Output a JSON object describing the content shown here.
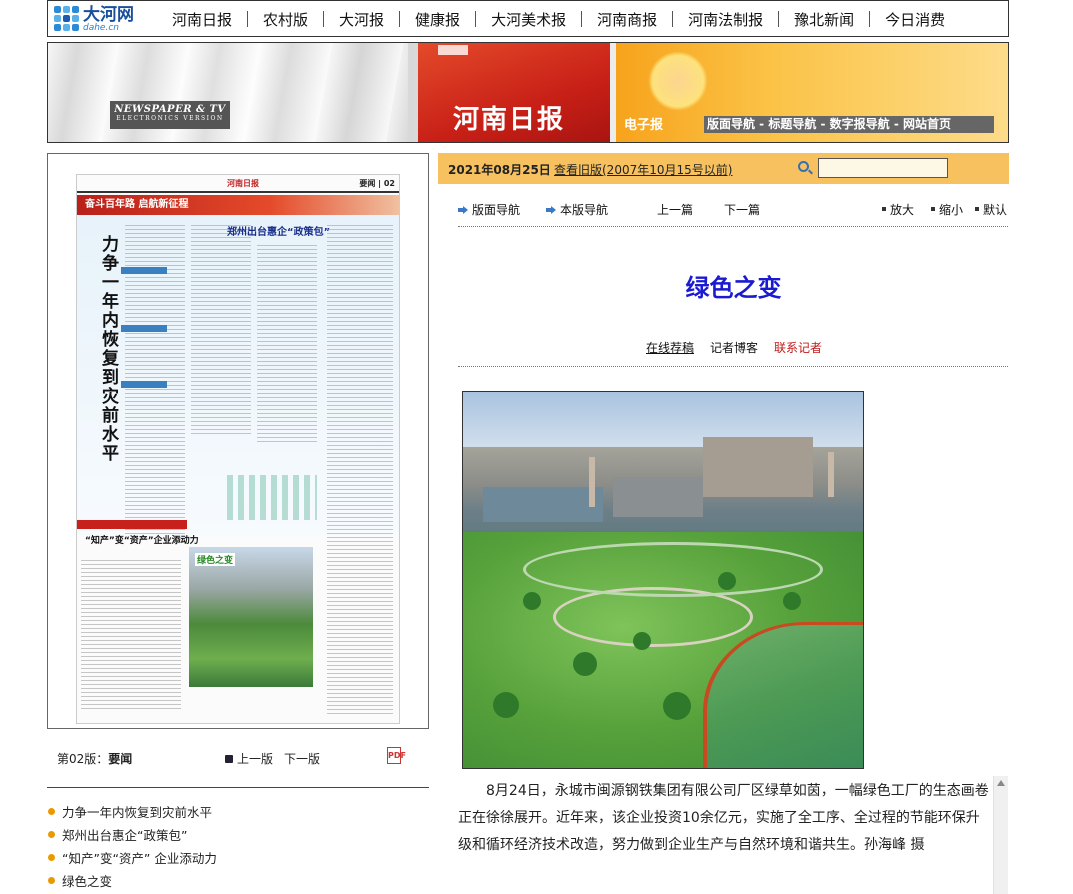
{
  "logo": {
    "cn": "大河网",
    "en": "dahe.cn"
  },
  "nav": [
    "河南日报",
    "农村版",
    "大河报",
    "健康报",
    "大河美术报",
    "河南商报",
    "河南法制报",
    "豫北新闻",
    "今日消费"
  ],
  "banner": {
    "en_line1": "NEWSPAPER & TV",
    "en_line2": "ELECTRONICS VERSION",
    "title": "河南日报",
    "epaper": "电子报",
    "links": "版面导航 - 标题导航 - 数字报导航 - 网站首页"
  },
  "thumbnail": {
    "header_left": "河南日报",
    "header_page": "要闻 | 02",
    "band": "奋斗百年路 启航新征程",
    "big_title": "力争一年内恢复到灾前水平",
    "sub1": "郑州出台惠企“政策包”",
    "sub2": "“知产”变“资产”企业添动力",
    "photo_label": "绿色之变"
  },
  "left_caption": {
    "page_prefix": "第02版：",
    "page_name": "要闻",
    "prev": "上一版",
    "next": "下一版",
    "pdf": "PDF"
  },
  "headlines": [
    "力争一年内恢复到灾前水平",
    "郑州出台惠企“政策包”",
    "“知产”变“资产” 企业添动力",
    "绿色之变"
  ],
  "date_bar": {
    "date": "2021年08月25日",
    "old_link": "查看旧版(2007年10月15号以前)",
    "search_placeholder": ""
  },
  "tools": {
    "layout_nav": "版面导航",
    "page_nav": "本版导航",
    "prev": "上一篇",
    "next": "下一篇",
    "zoom_in": "放大",
    "zoom_out": "缩小",
    "default": "默认"
  },
  "article": {
    "title": "绿色之变",
    "meta_online": "在线荐稿",
    "meta_blog": "记者博客",
    "meta_contact": "联系记者",
    "body": "8月24日，永城市闽源钢铁集团有限公司厂区绿草如茵，一幅绿色工厂的生态画卷正在徐徐展开。近年来，该企业投资10余亿元，实施了全工序、全过程的节能环保升级和循环经济技术改造，努力做到企业生产与自然环境和谐共生。孙海峰 摄"
  },
  "colors": {
    "date_bar": "#f6c15e",
    "title_blue": "#1a1ad0",
    "contact_red": "#c01818",
    "headline_dot": "#e89a00"
  }
}
